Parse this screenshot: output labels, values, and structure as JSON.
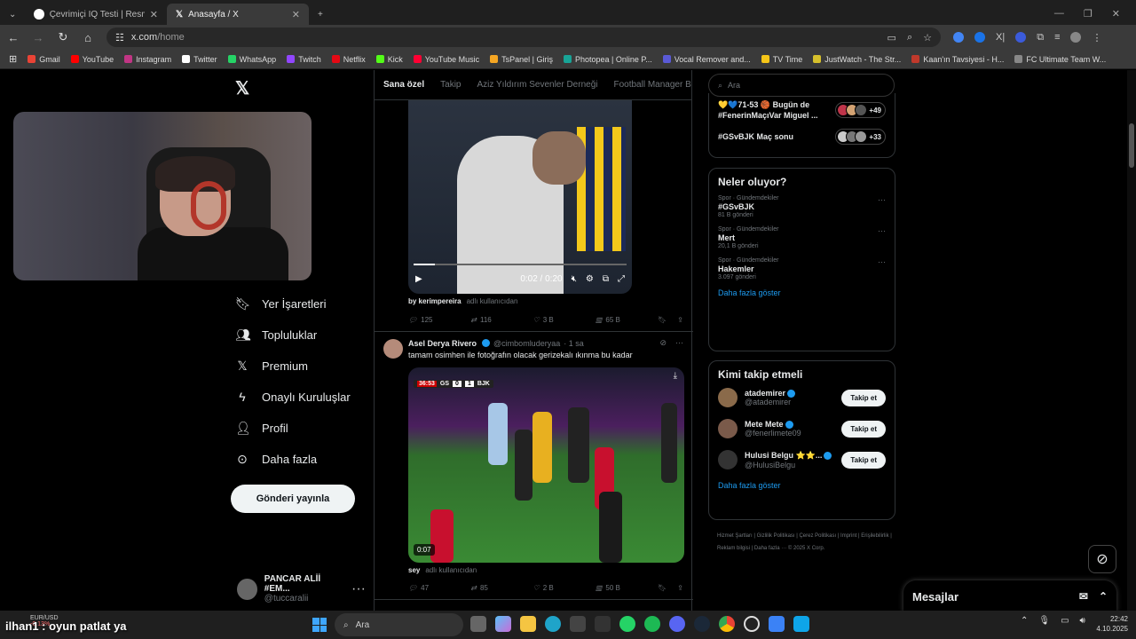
{
  "browser": {
    "tabs": [
      {
        "title": "Çevrimiçi IQ Testi | Resmi Mensa",
        "active": false
      },
      {
        "title": "Anasayfa / X",
        "active": true
      }
    ],
    "new_tab": "+",
    "url_prefix": "x.com",
    "url_path": "/home",
    "bookmarks": [
      "Gmail",
      "YouTube",
      "Instagram",
      "Twitter",
      "WhatsApp",
      "Twitch",
      "Netflix",
      "Kick",
      "YouTube Music",
      "TsPanel | Giriş",
      "Photopea | Online P...",
      "Vocal Remover and...",
      "TV Time",
      "JustWatch - The Str...",
      "Kaan'ın Tavsiyesi - H...",
      "FC Ultimate Team W..."
    ],
    "bookmark_colors": [
      "#ea4335",
      "#ff0000",
      "#c13584",
      "#ffffff",
      "#25d366",
      "#9146ff",
      "#e50914",
      "#53fc18",
      "#ff0033",
      "#f5a623",
      "#18a497",
      "#5a5ad6",
      "#f5c518",
      "#d6c02c",
      "#c0392b",
      "#888888"
    ]
  },
  "sidebar": {
    "items": [
      {
        "label": "Yer İşaretleri",
        "icon": "bookmark-icon"
      },
      {
        "label": "Topluluklar",
        "icon": "communities-icon"
      },
      {
        "label": "Premium",
        "icon": "x-logo-icon"
      },
      {
        "label": "Onaylı Kuruluşlar",
        "icon": "lightning-icon"
      },
      {
        "label": "Profil",
        "icon": "person-icon"
      },
      {
        "label": "Daha fazla",
        "icon": "more-circle-icon"
      }
    ],
    "post_button": "Gönderi yayınla",
    "account": {
      "name": "PANCAR ALİİ #EM...",
      "handle": "@tuccaralii"
    }
  },
  "feed": {
    "tabs": [
      "Sana özel",
      "Takip",
      "Aziz Yıldırım Sevenler Derneği",
      "Football Manager Bağım"
    ],
    "tweet1": {
      "video_time": "0:02 / 0:20",
      "progress": 0.1,
      "caption_user": "by kerimpereira",
      "caption_note": "adlı kullanıcıdan",
      "replies": "125",
      "retweets": "116",
      "likes": "3 B",
      "views": "65 B"
    },
    "tweet2": {
      "author": "Asel Derya Rivero",
      "handle": "@cimbomluderyaa",
      "time": "· 1 sa",
      "text": "tamam osimhen ile fotoğrafın olacak gerizekalı ıkınma bu kadar",
      "score_clock": "36:53",
      "home_team": "GS",
      "home_score": "0",
      "away_score": "1",
      "away_team": "BJK",
      "video_duration": "0:07",
      "caption_user": "sey",
      "caption_note": "adlı kullanıcıdan",
      "replies": "47",
      "retweets": "85",
      "likes": "2 B",
      "views": "50 B"
    }
  },
  "right": {
    "search_placeholder": "Ara",
    "top_trends": [
      {
        "label": "💛💙71-53 🏀 Bugün de #FenerinMaçıVar Miguel ...",
        "count": "+49"
      },
      {
        "label": "#GSvBJK Maç sonu",
        "count": "+33"
      }
    ],
    "happening_title": "Neler oluyor?",
    "trends": [
      {
        "category": "Spor · Gündemdekiler",
        "name": "#GSvBJK",
        "count": "81 B gönderi"
      },
      {
        "category": "Spor · Gündemdekiler",
        "name": "Mert",
        "count": "20,1 B gönderi"
      },
      {
        "category": "Spor · Gündemdekiler",
        "name": "Hakemler",
        "count": "3.097 gönderi"
      }
    ],
    "show_more": "Daha fazla göster",
    "who_title": "Kimi takip etmeli",
    "who": [
      {
        "name": "atademirer",
        "handle": "@atademirer",
        "button": "Takip et"
      },
      {
        "name": "Mete Mete",
        "handle": "@fenerlimete09",
        "button": "Takip et"
      },
      {
        "name": "Hulusi Belgu ⭐⭐...",
        "handle": "@HulusiBelgu",
        "button": "Takip et"
      }
    ],
    "who_more": "Daha fazla göster",
    "footer": "Hizmet Şartları  |  Gizlilik Politikası  |  Çerez Politikası  |  Imprint  |  Erişilebilirlik  |  Reklam bilgisi  |  Daha fazla ···  © 2025 X Corp."
  },
  "messages": {
    "title": "Mesajlar"
  },
  "taskbar": {
    "overlay": "ilhan1 : oyun patlat ya",
    "ticker_name": "EUR/USD",
    "ticker_value": "-0,13%",
    "search": "Ara",
    "time": "22:42",
    "date": "4.10.2025"
  }
}
